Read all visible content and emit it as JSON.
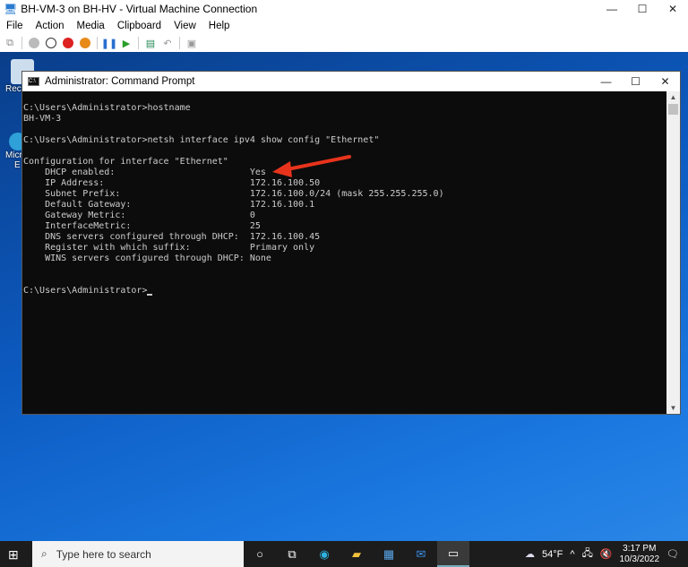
{
  "vm_window": {
    "title": "BH-VM-3 on BH-HV - Virtual Machine Connection",
    "menu": [
      "File",
      "Action",
      "Media",
      "Clipboard",
      "View",
      "Help"
    ]
  },
  "desktop_icons": [
    {
      "label": "Recy"
    },
    {
      "label": "Micr"
    },
    {
      "label": "E"
    }
  ],
  "console": {
    "title": "Administrator: Command Prompt",
    "lines": [
      "C:\\Users\\Administrator>hostname",
      "BH-VM-3",
      "",
      "C:\\Users\\Administrator>netsh interface ipv4 show config \"Ethernet\"",
      "",
      "Configuration for interface \"Ethernet\"",
      "    DHCP enabled:                         Yes",
      "    IP Address:                           172.16.100.50",
      "    Subnet Prefix:                        172.16.100.0/24 (mask 255.255.255.0)",
      "    Default Gateway:                      172.16.100.1",
      "    Gateway Metric:                       0",
      "    InterfaceMetric:                      25",
      "    DNS servers configured through DHCP:  172.16.100.45",
      "    Register with which suffix:           Primary only",
      "    WINS servers configured through DHCP: None",
      "",
      ""
    ],
    "prompt": "C:\\Users\\Administrator>"
  },
  "annotation_color": "#e8331c",
  "taskbar": {
    "search_placeholder": "Type here to search",
    "weather": "54°F",
    "time": "3:17 PM",
    "date": "10/3/2022"
  }
}
